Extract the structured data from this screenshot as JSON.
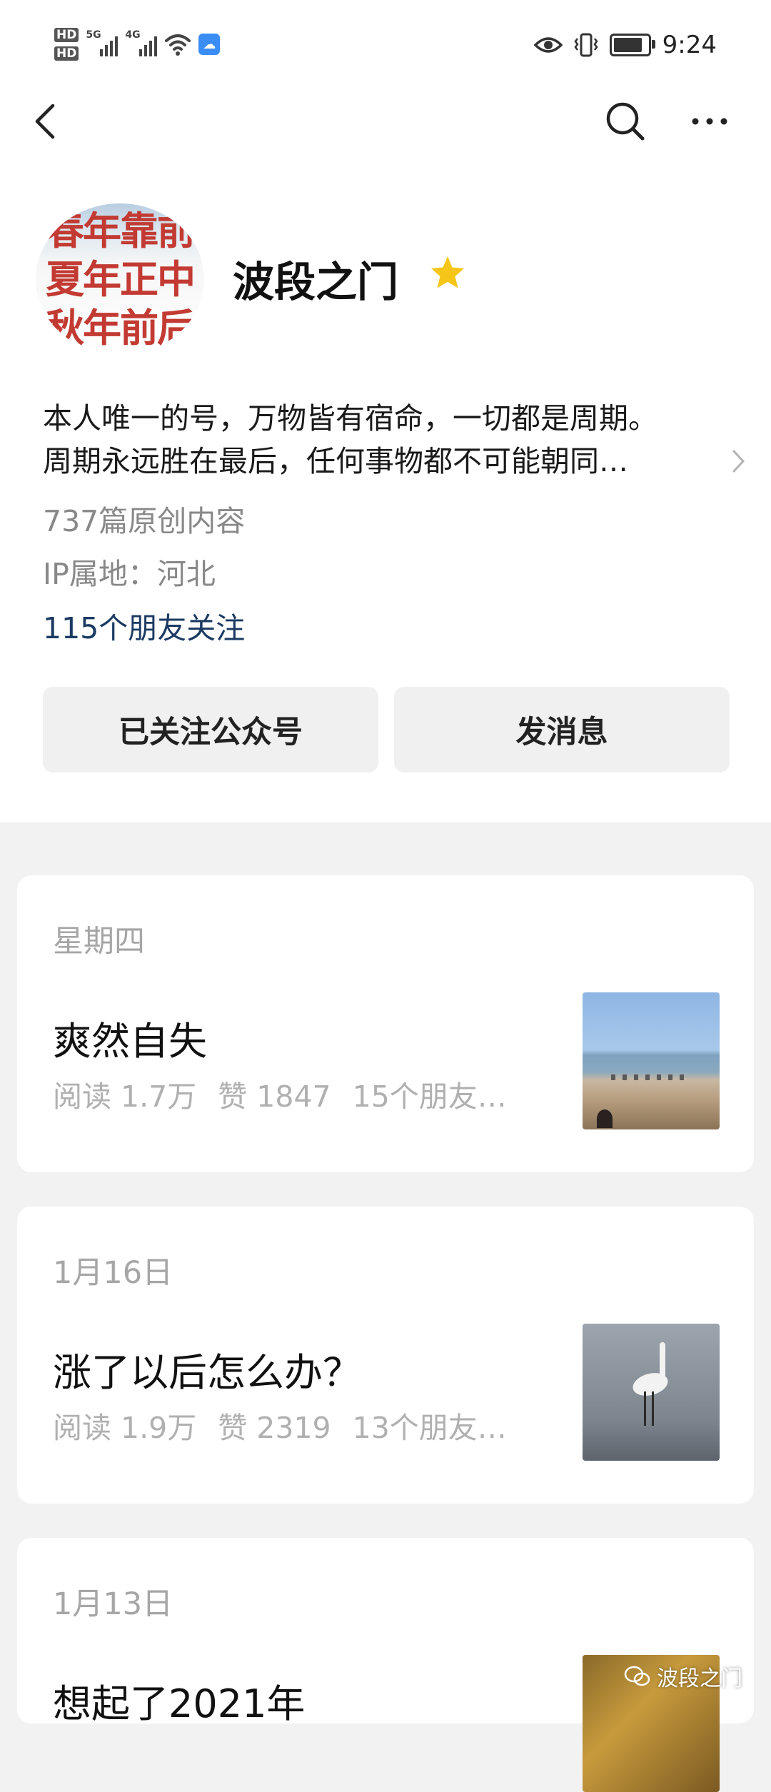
{
  "status_bar": {
    "hd1": "HD",
    "hd2": "HD",
    "net1": "5G",
    "net2": "4G",
    "time": "9:24",
    "battery_level": 0.85
  },
  "nav": {
    "back_icon": "chevron-left-icon",
    "search_icon": "search-icon",
    "more_icon": "more-horizontal-icon"
  },
  "profile": {
    "avatar_lines": [
      "春年靠前",
      "夏年正中",
      "秋年前后"
    ],
    "name": "波段之门",
    "verified_icon": "star-icon",
    "bio_line1": "本人唯一的号，万物皆有宿命，一切都是周期。",
    "bio_line2": "周期永远胜在最后，任何事物都不可能朝同…",
    "article_count": "737篇原创内容",
    "ip_location": "IP属地：河北",
    "friends_following": "115个朋友关注"
  },
  "actions": {
    "follow_label": "已关注公众号",
    "message_label": "发消息"
  },
  "articles": [
    {
      "date": "星期四",
      "title": "爽然自失",
      "reads": "阅读 1.7万",
      "likes": "赞 1847",
      "friends": "15个朋友…"
    },
    {
      "date": "1月16日",
      "title": "涨了以后怎么办？",
      "reads": "阅读 1.9万",
      "likes": "赞 2319",
      "friends": "13个朋友…"
    },
    {
      "date": "1月13日",
      "title": "想起了2021年"
    }
  ],
  "watermark": "波段之门",
  "colors": {
    "link": "#1b3a63",
    "star": "#f5c518",
    "page_bg": "#f2f2f2"
  }
}
